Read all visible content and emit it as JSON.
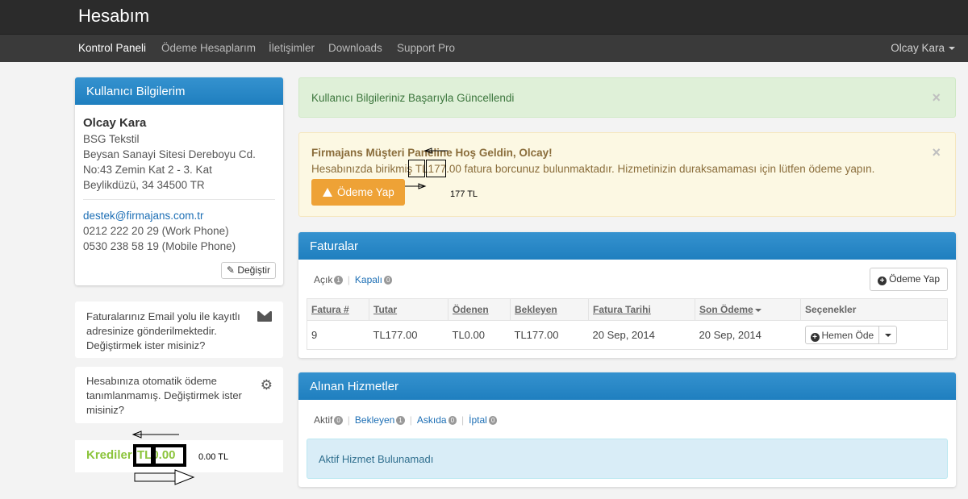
{
  "header": {
    "brand": "Hesabım",
    "nav": [
      "Kontrol Paneli",
      "Ödeme Hesaplarım",
      "İletişimler",
      "Downloads",
      "Support Pro"
    ],
    "user_menu": "Olcay Kara"
  },
  "user_panel": {
    "title": "Kullanıcı Bilgilerim",
    "name": "Olcay Kara",
    "company": "BSG Tekstil",
    "address1": "Beysan Sanayi Sitesi Dereboyu Cd.",
    "address2": "No:43 Zemin Kat 2 - 3. Kat",
    "address3": "Beylikdüzü, 34 34500 TR",
    "email": "destek@firmajans.com.tr",
    "phone_work": "0212 222 20 29 (Work Phone)",
    "phone_mobile": "0530 238 58 19 (Mobile Phone)",
    "edit_label": "Değiştir"
  },
  "email_notice": {
    "line1": "Faturalarınız Email yolu ile kayıtlı",
    "line2": "adresinize gönderilmektedir.",
    "line3": "Değiştirmek ister misiniz?"
  },
  "autopay_notice": {
    "line1": "Hesabınıza otomatik ödeme",
    "line2": "tanımlanmamış. Değiştirmek ister",
    "line3": "misiniz?"
  },
  "credits": {
    "label": "Krediler",
    "value": "TL0.00",
    "annotation": "0.00 TL"
  },
  "alerts": {
    "success": "Kullanıcı Bilgileriniz Başarıyla Güncellendi",
    "warning_title": "Firmajans Müşteri Paneline Hoş Geldin, Olcay!",
    "warning_text": "Hesabınızda birikmiş TL177.00 fatura borcunuz bulunmaktadır. Hizmetinizin duraksamaması için lütfen ödeme yapın.",
    "pay_button": "Ödeme Yap",
    "annotation": "177 TL",
    "close": "×"
  },
  "invoices": {
    "title": "Faturalar",
    "filters": [
      {
        "label": "Açık",
        "count": "1"
      },
      {
        "label": "Kapalı",
        "count": "0"
      }
    ],
    "pay_button": "Ödeme Yap",
    "columns": [
      "Fatura #",
      "Tutar",
      "Ödenen",
      "Bekleyen",
      "Fatura Tarihi",
      "Son Ödeme",
      "Seçenekler"
    ],
    "rows": [
      {
        "id": "9",
        "amount": "TL177.00",
        "paid": "TL0.00",
        "due": "TL177.00",
        "date": "20 Sep, 2014",
        "due_date": "20 Sep, 2014",
        "action": "Hemen Öde"
      }
    ]
  },
  "services": {
    "title": "Alınan Hizmetler",
    "filters": [
      {
        "label": "Aktif",
        "count": "0"
      },
      {
        "label": "Bekleyen",
        "count": "1"
      },
      {
        "label": "Askıda",
        "count": "0"
      },
      {
        "label": "İptal",
        "count": "0"
      }
    ],
    "empty": "Aktif Hizmet Bulunamadı"
  }
}
